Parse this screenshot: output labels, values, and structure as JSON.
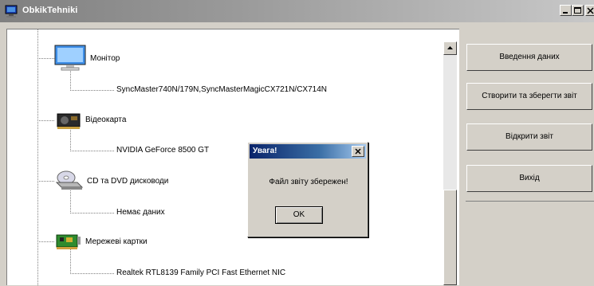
{
  "window": {
    "title": "ObkikTehniki",
    "icon": "computer-icon"
  },
  "caption_buttons": {
    "minimize_icon": "minimize-icon",
    "maximize_icon": "maximize-icon",
    "close_icon": "close-icon"
  },
  "tree": {
    "items": [
      {
        "label": "Монітор",
        "icon": "monitor-icon"
      },
      {
        "label": "SyncMaster740N/179N,SyncMasterMagicCX721N/CX714N",
        "icon": ""
      },
      {
        "label": "Відеокарта",
        "icon": "video-card-icon"
      },
      {
        "label": "NVIDIA GeForce 8500 GT",
        "icon": ""
      },
      {
        "label": "CD та DVD дисководи",
        "icon": "cd-drive-icon"
      },
      {
        "label": "Немає даних",
        "icon": ""
      },
      {
        "label": "Мережеві картки",
        "icon": "network-card-icon"
      },
      {
        "label": "Realtek RTL8139 Family PCI Fast Ethernet NIC",
        "icon": ""
      }
    ]
  },
  "buttons": {
    "data_entry": "Введення даних",
    "create_report": "Створити та зберегти звіт",
    "open_report": "Відкрити звіт",
    "exit": "Вихід"
  },
  "dialog": {
    "title": "Увага!",
    "message": "Файл звіту збережен!",
    "ok_label": "OK"
  },
  "colors": {
    "title_gradient_start": "#808080",
    "dialog_title_start": "#0a246a",
    "dialog_title_end": "#a6caf0",
    "face": "#d4d0c8"
  }
}
